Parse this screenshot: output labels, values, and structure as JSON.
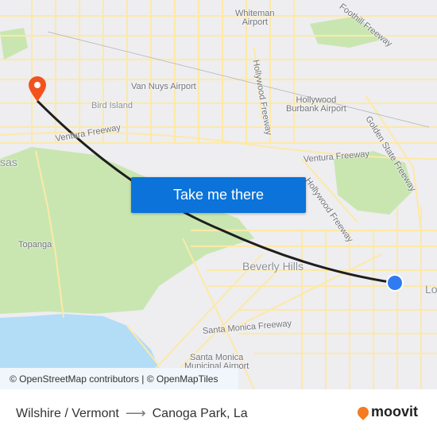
{
  "map": {
    "labels": {
      "whiteman_airport": "Whiteman\nAirport",
      "foothill_freeway": "Foothill Freeway",
      "van_nuys_airport": "Van Nuys Airport",
      "hollywood_freeway_north": "Hollywood Freeway",
      "hollywood_burbank_airport": "Hollywood\nBurbank Airport",
      "bird_island": "Bird Island",
      "golden_state_freeway": "Golden State Freeway",
      "ventura_freeway_west": "Ventura Freeway",
      "ventura_freeway_east": "Ventura Freeway",
      "hollywood_freeway_south": "Hollywood Freeway",
      "calabasas_partial": "sas",
      "topanga": "Topanga",
      "beverly_hills": "Beverly Hills",
      "santa_monica_freeway": "Santa Monica Freeway",
      "santa_monica_airport": "Santa Monica\nMunicipal Airport",
      "los_angeles_partial": "Los"
    },
    "colors": {
      "land": "#eeedf0",
      "park": "#c9e6b1",
      "water": "#b3dcf7",
      "road": "#fde9a6",
      "route_line": "#1e1e1e",
      "origin_marker": "#2f7bf2",
      "destination_marker": "#f2531d"
    },
    "origin": "Wilshire / Vermont",
    "destination": "Canoga Park, La"
  },
  "cta": {
    "label": "Take me there",
    "color": "#0b73d9"
  },
  "attribution": "© OpenStreetMap contributors | © OpenMapTiles",
  "footer": {
    "origin": "Wilshire / Vermont",
    "arrow": "⟶",
    "destination": "Canoga Park, La",
    "brand": "moovit",
    "brand_color": "#f47b20"
  }
}
